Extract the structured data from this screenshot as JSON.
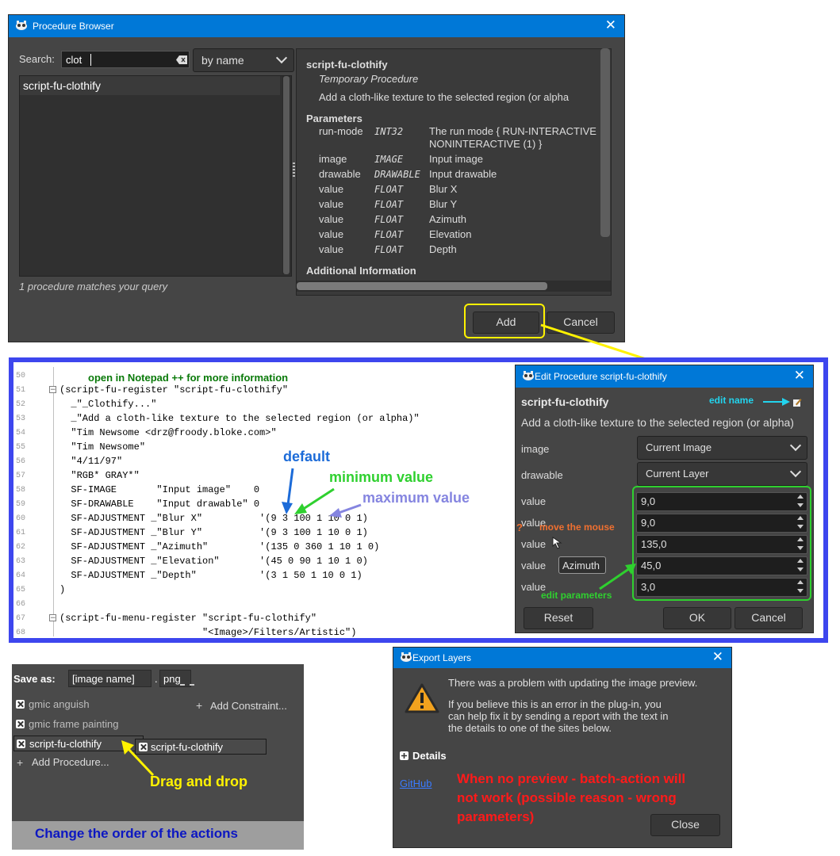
{
  "procedure_browser": {
    "title": "Procedure Browser",
    "search_label": "Search:",
    "search_value": "clot",
    "search_mode": "by name",
    "list": [
      "script-fu-clothify"
    ],
    "match_count": "1 procedure matches your query",
    "proc_name": "script-fu-clothify",
    "proc_type": "Temporary Procedure",
    "proc_desc": "Add a cloth-like texture to the selected region (or alpha",
    "params_header": "Parameters",
    "params": [
      {
        "name": "run-mode",
        "type": "INT32",
        "desc": "The run mode { RUN-INTERACTIVE",
        "desc2": "NONINTERACTIVE (1) }"
      },
      {
        "name": "image",
        "type": "IMAGE",
        "desc": "Input image"
      },
      {
        "name": "drawable",
        "type": "DRAWABLE",
        "desc": "Input drawable"
      },
      {
        "name": "value",
        "type": "FLOAT",
        "desc": "Blur X"
      },
      {
        "name": "value",
        "type": "FLOAT",
        "desc": "Blur Y"
      },
      {
        "name": "value",
        "type": "FLOAT",
        "desc": "Azimuth"
      },
      {
        "name": "value",
        "type": "FLOAT",
        "desc": "Elevation"
      },
      {
        "name": "value",
        "type": "FLOAT",
        "desc": "Depth"
      }
    ],
    "additional_info": "Additional Information",
    "add_label": "Add",
    "cancel_label": "Cancel"
  },
  "code_editor": {
    "note": "open in Notepad ++ for more information",
    "lines": [
      {
        "n": "50",
        "t": ""
      },
      {
        "n": "51",
        "t": "(script-fu-register \"script-fu-clothify\""
      },
      {
        "n": "52",
        "t": "  _\"_Clothify...\""
      },
      {
        "n": "53",
        "t": "  _\"Add a cloth-like texture to the selected region (or alpha)\""
      },
      {
        "n": "54",
        "t": "  \"Tim Newsome <drz@froody.bloke.com>\""
      },
      {
        "n": "55",
        "t": "  \"Tim Newsome\""
      },
      {
        "n": "56",
        "t": "  \"4/11/97\""
      },
      {
        "n": "57",
        "t": "  \"RGB* GRAY*\""
      },
      {
        "n": "58",
        "t": "  SF-IMAGE       \"Input image\"    0"
      },
      {
        "n": "59",
        "t": "  SF-DRAWABLE    \"Input drawable\" 0"
      },
      {
        "n": "60",
        "t": "  SF-ADJUSTMENT _\"Blur X\"          '(9 3 100 1 10 0 1)"
      },
      {
        "n": "61",
        "t": "  SF-ADJUSTMENT _\"Blur Y\"          '(9 3 100 1 10 0 1)"
      },
      {
        "n": "62",
        "t": "  SF-ADJUSTMENT _\"Azimuth\"         '(135 0 360 1 10 1 0)"
      },
      {
        "n": "63",
        "t": "  SF-ADJUSTMENT _\"Elevation\"       '(45 0 90 1 10 1 0)"
      },
      {
        "n": "64",
        "t": "  SF-ADJUSTMENT _\"Depth\"           '(3 1 50 1 10 0 1)"
      },
      {
        "n": "65",
        "t": ")"
      },
      {
        "n": "66",
        "t": ""
      },
      {
        "n": "67",
        "t": "(script-fu-menu-register \"script-fu-clothify\""
      },
      {
        "n": "68",
        "t": "                         \"<Image>/Filters/Artistic\")"
      }
    ],
    "label_default": "default",
    "label_min": "minimum value",
    "label_max": "maximum value"
  },
  "edit_procedure": {
    "title": "Edit Procedure script-fu-clothify",
    "name": "script-fu-clothify",
    "edit_name_note": "edit name",
    "desc": "Add a cloth-like texture to the selected region (or alpha)",
    "image_label": "image",
    "image_value": "Current Image",
    "drawable_label": "drawable",
    "drawable_value": "Current Layer",
    "values": [
      {
        "label": "value",
        "value": "9,0"
      },
      {
        "label": "value",
        "value": "9,0"
      },
      {
        "label": "value",
        "value": "135,0"
      },
      {
        "label": "value",
        "value": "45,0"
      },
      {
        "label": "value",
        "value": "3,0"
      }
    ],
    "tooltip": "Azimuth",
    "question": "?",
    "move_mouse_note": "move the mouse",
    "edit_params_note": "edit parameters",
    "reset_label": "Reset",
    "ok_label": "OK",
    "cancel_label": "Cancel"
  },
  "batch_panel": {
    "save_as_label": "Save as:",
    "filename": "[image name]",
    "dot": ".",
    "ext": "png",
    "add_constraint": "Add Constraint...",
    "procedures": [
      "gmic anguish",
      "gmic frame painting",
      "script-fu-clothify"
    ],
    "dragged_item": "script-fu-clothify",
    "add_procedure": "Add Procedure...",
    "drag_note": "Drag and drop",
    "order_note": "Change the order of the actions"
  },
  "export_layers": {
    "title": "Export Layers",
    "message1": "There was a problem with updating the image preview.",
    "message2": [
      "If you believe this is an error in the plug-in, you",
      "can help fix it by sending a report with the text in",
      "the details to one of the sites below."
    ],
    "details_label": "Details",
    "github_link": "GitHub",
    "warning_note": [
      "When no preview - batch-action will",
      "not work (possible reason - wrong",
      "parameters)"
    ],
    "close_label": "Close"
  }
}
